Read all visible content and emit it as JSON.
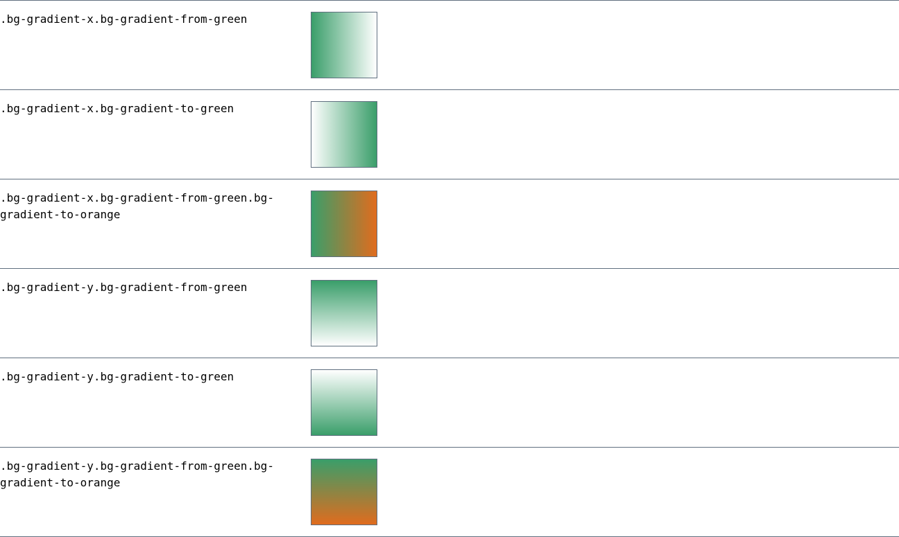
{
  "rows": [
    {
      "label": ".bg-gradient-x.bg-gradient-from-green",
      "direction": "x",
      "from": "#3a9e6a",
      "to": "#ffffff"
    },
    {
      "label": ".bg-gradient-x.bg-gradient-to-green",
      "direction": "x",
      "from": "#ffffff",
      "to": "#3a9e6a"
    },
    {
      "label": ".bg-gradient-x.bg-gradient-from-green.bg-gradient-to-orange",
      "direction": "x",
      "from": "#3a9e6a",
      "to": "#e06c1e"
    },
    {
      "label": ".bg-gradient-y.bg-gradient-from-green",
      "direction": "y",
      "from": "#3a9e6a",
      "to": "#ffffff"
    },
    {
      "label": ".bg-gradient-y.bg-gradient-to-green",
      "direction": "y",
      "from": "#ffffff",
      "to": "#3a9e6a"
    },
    {
      "label": ".bg-gradient-y.bg-gradient-from-green.bg-gradient-to-orange",
      "direction": "y",
      "from": "#3a9e6a",
      "to": "#e06c1e"
    }
  ]
}
